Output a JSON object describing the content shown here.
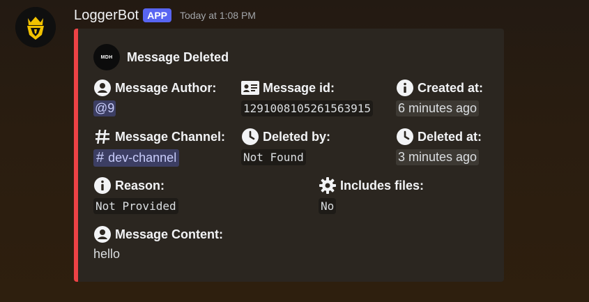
{
  "message": {
    "username": "LoggerBot",
    "badge": "APP",
    "timestamp": "Today at 1:08 PM"
  },
  "embed": {
    "accent_color": "#ed4245",
    "author_icon_text": "MDH",
    "title": "Message Deleted",
    "fields": {
      "author": {
        "name": "Message Author:",
        "value": "@9",
        "icon": "user-icon"
      },
      "message_id": {
        "name": "Message id:",
        "value": "1291008105261563915",
        "icon": "id-card-icon"
      },
      "created_at": {
        "name": "Created at:",
        "value": "6 minutes ago",
        "icon": "info-icon"
      },
      "channel": {
        "name": "Message Channel:",
        "value": "dev-channel",
        "icon": "hash-icon",
        "hash": "#"
      },
      "deleted_by": {
        "name": "Deleted by:",
        "value": "Not Found",
        "icon": "clock-icon"
      },
      "deleted_at": {
        "name": "Deleted at:",
        "value": "3 minutes ago",
        "icon": "clock-icon"
      },
      "reason": {
        "name": "Reason:",
        "value": "Not Provided",
        "icon": "info-icon"
      },
      "includes_files": {
        "name": "Includes files:",
        "value": "No",
        "icon": "gear-icon"
      },
      "content": {
        "name": "Message Content:",
        "value": "hello",
        "icon": "user-icon"
      }
    }
  }
}
